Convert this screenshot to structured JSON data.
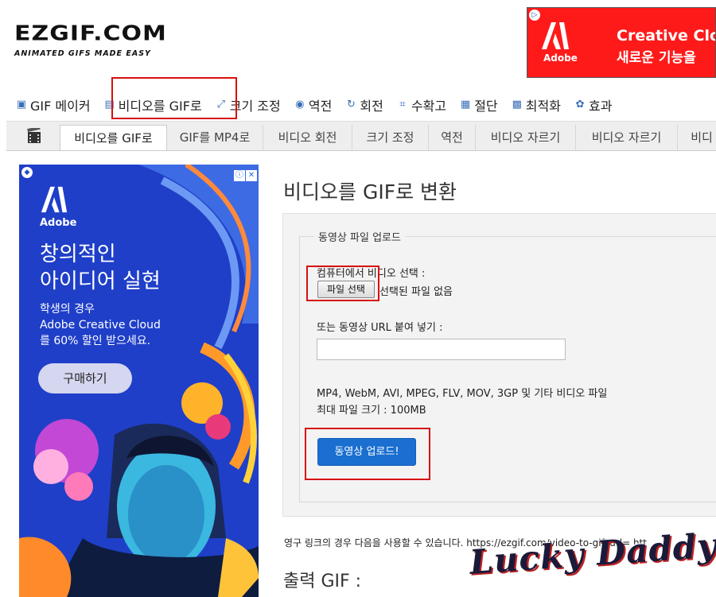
{
  "logo": {
    "main": "EZGIF.COM",
    "tagline": "ANIMATED GIFS MADE EASY"
  },
  "top_ad": {
    "brand": "Adobe",
    "line1": "Creative Clou",
    "line2": "새로운 기능을",
    "adchoices": "▷"
  },
  "main_nav": [
    {
      "label": "GIF 메이커",
      "icon": "gif-maker-icon",
      "glyph": "▣"
    },
    {
      "label": "비디오를 GIF로",
      "icon": "video-icon",
      "glyph": "▤"
    },
    {
      "label": "크기 조정",
      "icon": "resize-icon",
      "glyph": "⤢"
    },
    {
      "label": "역전",
      "icon": "reverse-icon",
      "glyph": "◉"
    },
    {
      "label": "회전",
      "icon": "rotate-icon",
      "glyph": "↻"
    },
    {
      "label": "수확고",
      "icon": "crop-icon",
      "glyph": "⌗"
    },
    {
      "label": "절단",
      "icon": "cut-icon",
      "glyph": "▦"
    },
    {
      "label": "최적화",
      "icon": "optimize-icon",
      "glyph": "▩"
    },
    {
      "label": "효과",
      "icon": "effects-icon",
      "glyph": "✿"
    }
  ],
  "sub_nav": [
    {
      "label": "비디오를 GIF로",
      "active": true
    },
    {
      "label": "GIF를 MP4로",
      "active": false
    },
    {
      "label": "비디오 회전",
      "active": false
    },
    {
      "label": "크기 조정",
      "active": false
    },
    {
      "label": "역전",
      "active": false
    },
    {
      "label": "비디오 자르기",
      "active": false
    },
    {
      "label": "비디오 자르기",
      "active": false
    },
    {
      "label": "비디",
      "active": false
    }
  ],
  "side_ad": {
    "brand": "Adobe",
    "headline_1": "창의적인",
    "headline_2": "아이디어 실현",
    "body_1": "학생의 경우",
    "body_2": "Adobe Creative Cloud",
    "body_3": "를 60% 할인 받으세요.",
    "cta": "구매하기",
    "info": "ⓘ",
    "close": "✕"
  },
  "page": {
    "title": "비디오를 GIF로 변환",
    "legend": "동영상 파일 업로드",
    "choose_label": "컴퓨터에서 비디오 선택 :",
    "file_button": "파일 선택",
    "no_file": "선택된 파일 없음",
    "url_label": "또는 동영상 URL 붙여 넣기 :",
    "url_value": "",
    "formats": "MP4, WebM, AVI, MPEG, FLV, MOV, 3GP 및 기타 비디오 파일",
    "max_size": "최대 파일 크기 : 100MB",
    "upload_button": "동영상 업로드!",
    "permalink": "영구 링크의 경우 다음을 사용할 수 있습니다. https://ezgif.com/video-to-gif?url= htt",
    "output_title": "출력 GIF :"
  },
  "watermark": "Lucky Daddy",
  "colors": {
    "accent": "#1a6fd0",
    "highlight": "#d80f0f",
    "ad_blue": "#1f3fc8",
    "ad_red": "#ff1a1a"
  }
}
